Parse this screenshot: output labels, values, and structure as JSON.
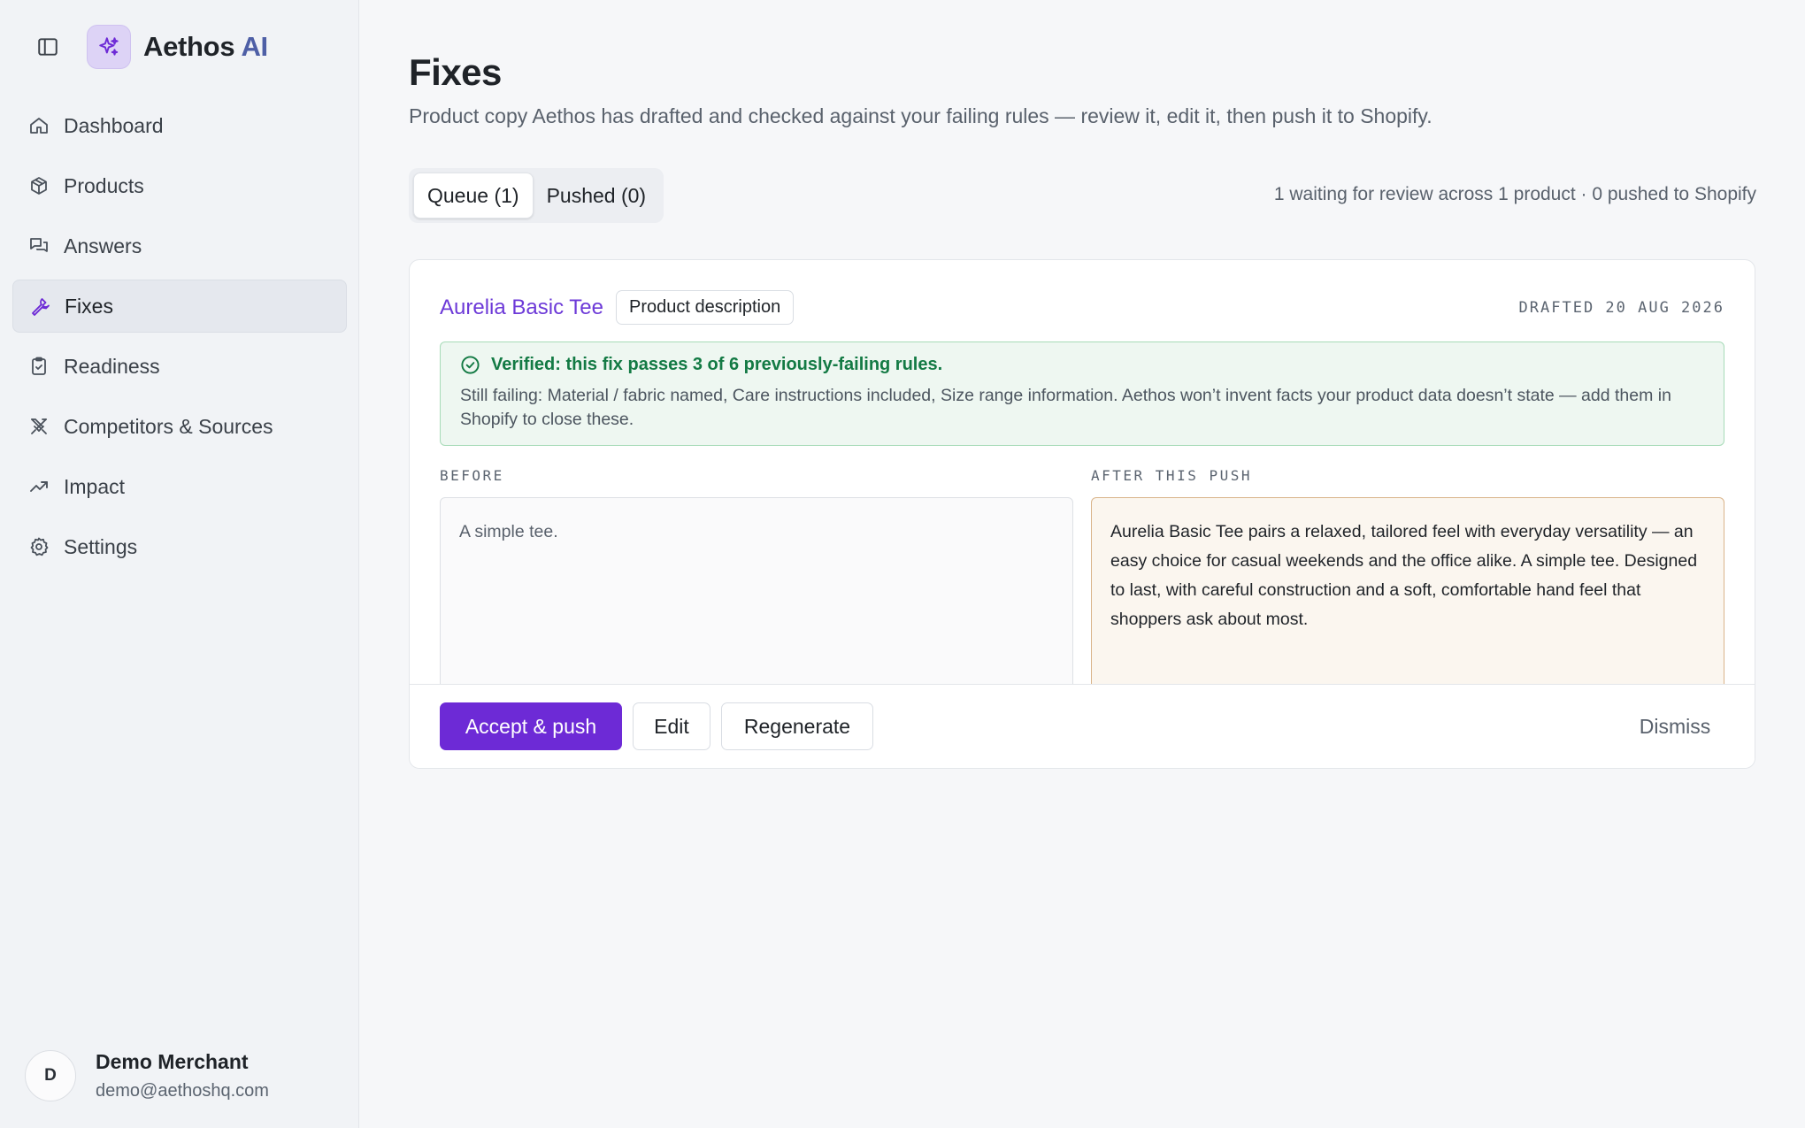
{
  "brand": {
    "name": "Aethos",
    "accent": "AI"
  },
  "sidebar": {
    "items": [
      {
        "label": "Dashboard",
        "icon": "home-icon"
      },
      {
        "label": "Products",
        "icon": "box-icon"
      },
      {
        "label": "Answers",
        "icon": "chat-icon"
      },
      {
        "label": "Fixes",
        "icon": "wrench-icon",
        "active": true
      },
      {
        "label": "Readiness",
        "icon": "clipboard-check-icon"
      },
      {
        "label": "Competitors & Sources",
        "icon": "swords-icon"
      },
      {
        "label": "Impact",
        "icon": "trend-up-icon"
      },
      {
        "label": "Settings",
        "icon": "gear-icon"
      }
    ]
  },
  "account": {
    "initial": "D",
    "name": "Demo Merchant",
    "email": "demo@aethoshq.com"
  },
  "page": {
    "title": "Fixes",
    "subtitle": "Product copy Aethos has drafted and checked against your failing rules — review it, edit it, then push it to Shopify."
  },
  "tabs": [
    {
      "label": "Queue (1)",
      "active": true
    },
    {
      "label": "Pushed (0)",
      "active": false
    }
  ],
  "summary": "1 waiting for review across 1 product · 0 pushed to Shopify",
  "fix": {
    "product": "Aurelia Basic Tee",
    "field": "Product description",
    "drafted": "DRAFTED 20 AUG 2026",
    "verified_title": "Verified: this fix passes 3 of 6 previously-failing rules.",
    "verified_body": "Still failing: Material / fabric named, Care instructions included, Size range information. Aethos won’t invent facts your product data doesn’t state — add them in Shopify to close these.",
    "before_label": "BEFORE",
    "before_text": "A simple tee.",
    "after_label": "AFTER THIS PUSH",
    "after_text": "Aurelia Basic Tee pairs a relaxed, tailored feel with everyday versatility — an easy choice for casual weekends and the office alike. A simple tee. Designed to last, with careful construction and a soft, comfortable hand feel that shoppers ask about most."
  },
  "actions": {
    "accept": "Accept & push",
    "edit": "Edit",
    "regenerate": "Regenerate",
    "dismiss": "Dismiss"
  },
  "colors": {
    "accent": "#6d2ad6",
    "link": "#6d3ad8",
    "verified_green": "#137a44",
    "after_border": "#d9b48a"
  }
}
